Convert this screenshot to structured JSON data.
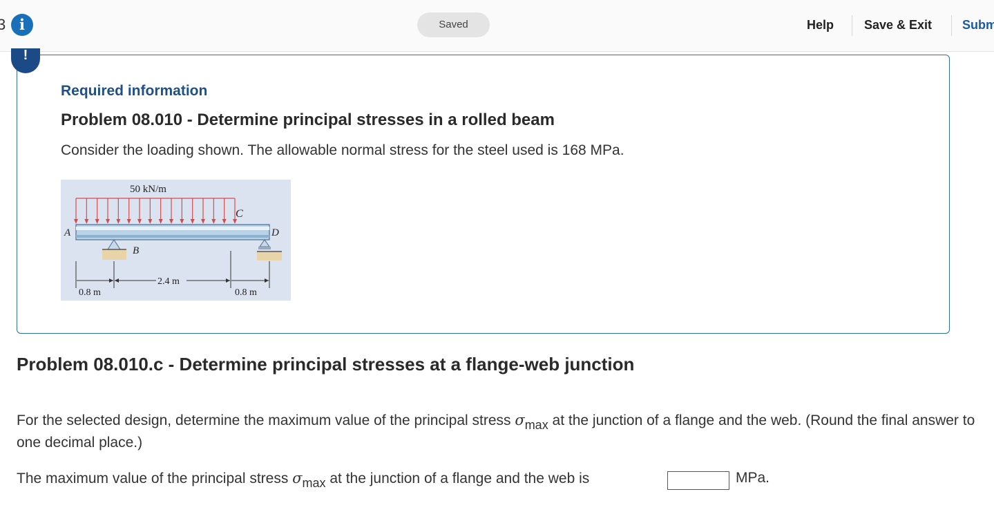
{
  "header": {
    "question_number": "3",
    "info_icon": "i",
    "saved_label": "Saved",
    "help_label": "Help",
    "save_exit_label": "Save & Exit",
    "submit_label": "Submit"
  },
  "required_info": {
    "alert_icon": "!",
    "heading": "Required information",
    "problem_title": "Problem 08.010 - Determine principal stresses in a rolled beam",
    "problem_text": "Consider the loading shown. The allowable normal stress for the steel used is 168 MPa."
  },
  "figure": {
    "load_label": "50 kN/m",
    "point_a": "A",
    "point_b": "B",
    "point_c": "C",
    "point_d": "D",
    "dim_left": "0.8 m",
    "dim_middle": "2.4 m",
    "dim_right": "0.8 m"
  },
  "question": {
    "title": "Problem 08.010.c - Determine principal stresses at a flange-web junction",
    "para_part1": "For the selected design, determine the maximum value of the principal stress ",
    "sigma": "σ",
    "sigma_sub": "max",
    "para_part2": " at the junction of a flange and the web. (Round the final answer to one decimal place.)",
    "answer_part1": "The maximum value of the principal stress ",
    "answer_part2": " at the junction of a flange and the web is",
    "answer_value": "",
    "unit": "MPa."
  },
  "colors": {
    "accent_blue": "#1a6fba",
    "heading_blue": "#1e4f86",
    "box_border": "#2f6fa6",
    "load_arrow_red": "#d84a4a",
    "figure_bg": "#dbe3f1"
  }
}
